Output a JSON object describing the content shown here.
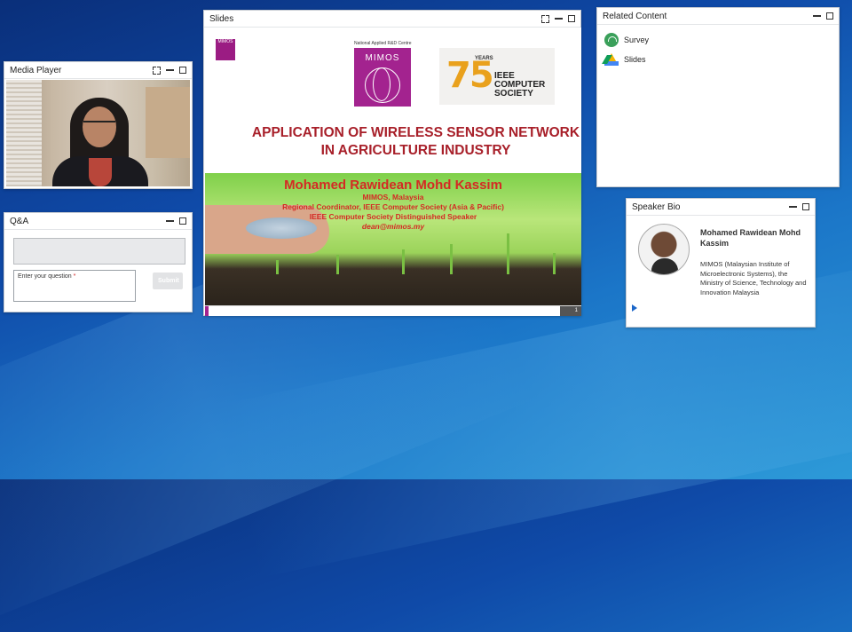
{
  "media_player": {
    "title": "Media Player"
  },
  "qa": {
    "title": "Q&A",
    "input_placeholder": "Enter your question",
    "required_mark": "*",
    "submit_label": "Submit"
  },
  "slides": {
    "title": "Slides",
    "header_small": "National Applied R&D Centre",
    "mimos_logo_text": "MIMOS",
    "ieee_years": "YEARS",
    "ieee_number": "75",
    "ieee_text": "IEEE COMPUTER SOCIETY",
    "heading_line1": "APPLICATION OF WIRELESS SENSOR NETWORK",
    "heading_line2": "IN AGRICULTURE INDUSTRY",
    "presenter_name": "Mohamed Rawidean Mohd Kassim",
    "presenter_org": "MIMOS, Malaysia",
    "presenter_role1": "Regional Coordinator, IEEE Computer Society (Asia & Pacific)",
    "presenter_role2": "IEEE Computer Society Distinguished Speaker",
    "presenter_email": "dean@mimos.my",
    "page_number": "1"
  },
  "related": {
    "title": "Related Content",
    "items": [
      {
        "label": "Survey",
        "icon": "survey-icon"
      },
      {
        "label": "Slides",
        "icon": "google-drive-icon"
      }
    ]
  },
  "bio": {
    "title": "Speaker Bio",
    "name": "Mohamed Rawidean Mohd Kassim",
    "description": "MIMOS (Malaysian Institute of Microelectronic Systems), the Ministry of Science, Technology and Innovation Malaysia"
  }
}
